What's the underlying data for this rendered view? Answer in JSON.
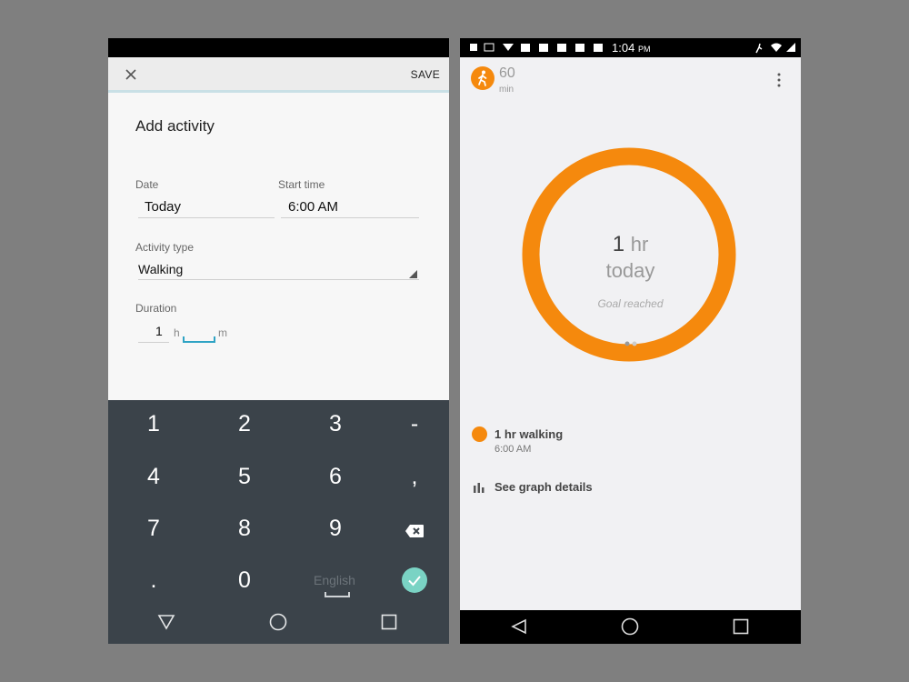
{
  "add_activity": {
    "save_label": "SAVE",
    "title": "Add activity",
    "date_label": "Date",
    "date_value": "Today",
    "start_time_label": "Start time",
    "start_time_value": "6:00 AM",
    "activity_type_label": "Activity type",
    "activity_type_value": "Walking",
    "duration_label": "Duration",
    "hours_value": "1",
    "hours_unit": "h",
    "minutes_value": "",
    "minutes_unit": "m"
  },
  "keyboard": {
    "keys": [
      "1",
      "2",
      "3",
      "-",
      "4",
      "5",
      "6",
      ",",
      "7",
      "8",
      "9",
      "⌫",
      ".",
      "0"
    ],
    "language": "English"
  },
  "dashboard": {
    "status_time": "1:04",
    "status_ampm": "PM",
    "goal_value": "60",
    "goal_unit": "min",
    "progress_fraction": 1.0,
    "ring_value": "1",
    "ring_unit": "hr",
    "ring_period": "today",
    "ring_status": "Goal reached",
    "activity_title": "1 hr walking",
    "activity_time": "6:00 AM",
    "graph_link": "See graph details",
    "accent_color": "#f5890d"
  },
  "icons": [
    "close-icon",
    "dropdown-arrow-icon",
    "check-icon",
    "backspace-icon",
    "walking-icon",
    "more-vert-icon",
    "bar-chart-icon",
    "back-nav-icon",
    "home-nav-icon",
    "recents-nav-icon"
  ]
}
